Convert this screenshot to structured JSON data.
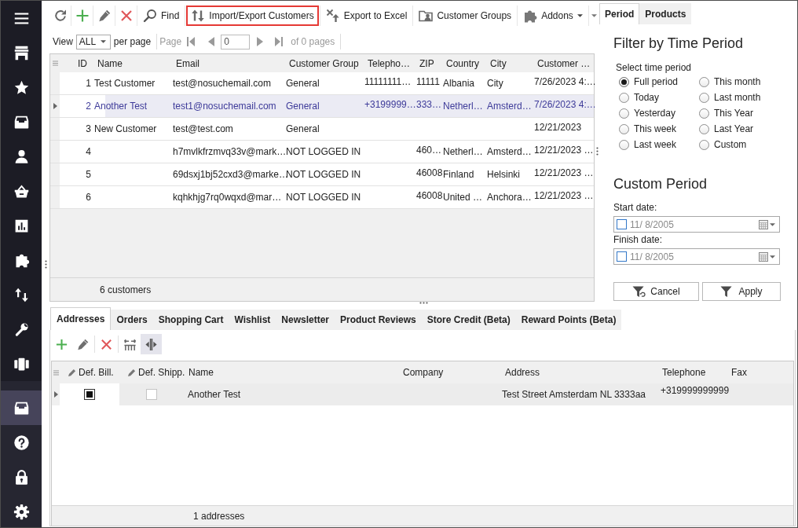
{
  "sidebar": {
    "items": [
      {
        "selected": false
      },
      {
        "selected": false
      },
      {
        "selected": false
      },
      {
        "selected": false
      },
      {
        "selected": false
      },
      {
        "selected": false
      },
      {
        "selected": false
      },
      {
        "selected": false
      },
      {
        "selected": false
      },
      {
        "selected": false
      }
    ],
    "bottom_items": [
      {
        "selected": true
      },
      {
        "selected": false
      },
      {
        "selected": false
      },
      {
        "selected": false
      }
    ]
  },
  "toolbar": {
    "buttons": [
      {
        "kind": "button",
        "label": "Find",
        "highlighted": false
      },
      {
        "kind": "button",
        "label": "Import/Export Customers",
        "highlighted": true
      },
      {
        "kind": "button",
        "label": "Export to Excel",
        "highlighted": false
      },
      {
        "kind": "button",
        "label": "Customer Groups",
        "highlighted": false
      },
      {
        "kind": "dropdown",
        "label": "Addons",
        "highlighted": false
      }
    ]
  },
  "pager": {
    "view_label": "View",
    "page_size": "ALL",
    "per_page_label": "per page",
    "page_label": "Page",
    "page": "0",
    "total": "of 0 pages",
    "disabled": true
  },
  "customers_table": {
    "columns": [
      "ID",
      "Name",
      "Email",
      "Customer Group",
      "Telepho…",
      "ZIP",
      "Country",
      "City",
      "Customer …"
    ],
    "rows": [
      {
        "id": "1",
        "name": "Test Customer",
        "email": "test@nosuchemail.com",
        "customer_group": "General",
        "telephone": "11111111…",
        "zip": "11111",
        "country": "Albania",
        "city": "City",
        "column_9": "7/26/2023 4:…",
        "selected": false
      },
      {
        "id": "2",
        "name": "Another Test",
        "email": "test1@nosuchemail.com",
        "customer_group": "General",
        "telephone": "+3199999…",
        "zip": "333…",
        "country": "Netherl…",
        "city": "Amsterd…",
        "column_9": "7/26/2023 4:…",
        "selected": true
      },
      {
        "id": "3",
        "name": "New Customer",
        "email": "test@test.com",
        "customer_group": "General",
        "column_9": "12/21/2023",
        "selected": false
      },
      {
        "id": "4",
        "email": "h7mvlkfrzmvq33v@mark…",
        "customer_group": "NOT LOGGED IN",
        "zip": "460…",
        "country": "Netherl…",
        "city": "Amsterd…",
        "column_9": "12/21/2023 …",
        "selected": false
      },
      {
        "id": "5",
        "email": "69dsxj1bj52cxd3@marke…",
        "customer_group": "NOT LOGGED IN",
        "zip": "46008",
        "country": "Finland",
        "city": "Helsinki",
        "column_9": "12/21/2023 …",
        "selected": false
      },
      {
        "id": "6",
        "email": "kqhkhjg7rq0wqxd@mar…",
        "customer_group": "NOT LOGGED IN",
        "zip": "46008",
        "country": "United …",
        "city": "Anchora…",
        "column_9": "12/21/2023 …",
        "selected": false
      }
    ],
    "footer": "6 customers"
  },
  "side_tabs": [
    {
      "label": "Period",
      "selected": true
    },
    {
      "label": "Products",
      "selected": false
    }
  ],
  "filter_panel": {
    "title": "Filter by Time Period",
    "group_label": "Select time period",
    "periods": [
      {
        "label": "Full period",
        "selected": true
      },
      {
        "label": "Today",
        "selected": false
      },
      {
        "label": "Yesterday",
        "selected": false
      },
      {
        "label": "This week",
        "selected": false
      },
      {
        "label": "Last week",
        "selected": false
      },
      {
        "label": "This month",
        "selected": false
      },
      {
        "label": "Last month",
        "selected": false
      },
      {
        "label": "This Year",
        "selected": false
      },
      {
        "label": "Last Year",
        "selected": false
      },
      {
        "label": "Custom",
        "selected": false
      }
    ],
    "custom_title": "Custom Period",
    "dates": [
      {
        "label": "Start date:",
        "value": "11/ 8/2005",
        "checked": false
      },
      {
        "label": "Finish date:",
        "value": "11/ 8/2005",
        "checked": false
      }
    ],
    "buttons": [
      {
        "label": "Cancel"
      },
      {
        "label": "Apply"
      }
    ]
  },
  "detail_tabs": [
    {
      "label": "Addresses",
      "selected": true
    },
    {
      "label": "Orders",
      "selected": false
    },
    {
      "label": "Shopping Cart",
      "selected": false
    },
    {
      "label": "Wishlist",
      "selected": false
    },
    {
      "label": "Newsletter",
      "selected": false
    },
    {
      "label": "Product Reviews",
      "selected": false
    },
    {
      "label": "Store Credit (Beta)",
      "selected": false
    },
    {
      "label": "Reward Points (Beta)",
      "selected": false
    }
  ],
  "detail_toolbar": [
    {
      "pressed": false
    },
    {
      "pressed": false
    },
    {
      "pressed": false
    },
    {
      "pressed": false
    },
    {
      "pressed": true
    }
  ],
  "addresses_table": {
    "columns": [
      {
        "label": "Def. Bill.",
        "editable": true
      },
      {
        "label": "Def. Shipp.",
        "editable": true
      },
      {
        "label": "Name",
        "editable": false
      },
      {
        "label": "Company",
        "editable": false
      },
      {
        "label": "Address",
        "editable": false
      },
      {
        "label": "Telephone",
        "editable": false
      },
      {
        "label": "Fax",
        "editable": false
      }
    ],
    "rows": [
      {
        "default_billing": true,
        "default_shipping": false,
        "name": "Another Test",
        "address": "Test Street Amsterdam NL 3333aa",
        "telephone": "+319999999999",
        "selected": true
      }
    ],
    "footer": "1 addresses"
  }
}
